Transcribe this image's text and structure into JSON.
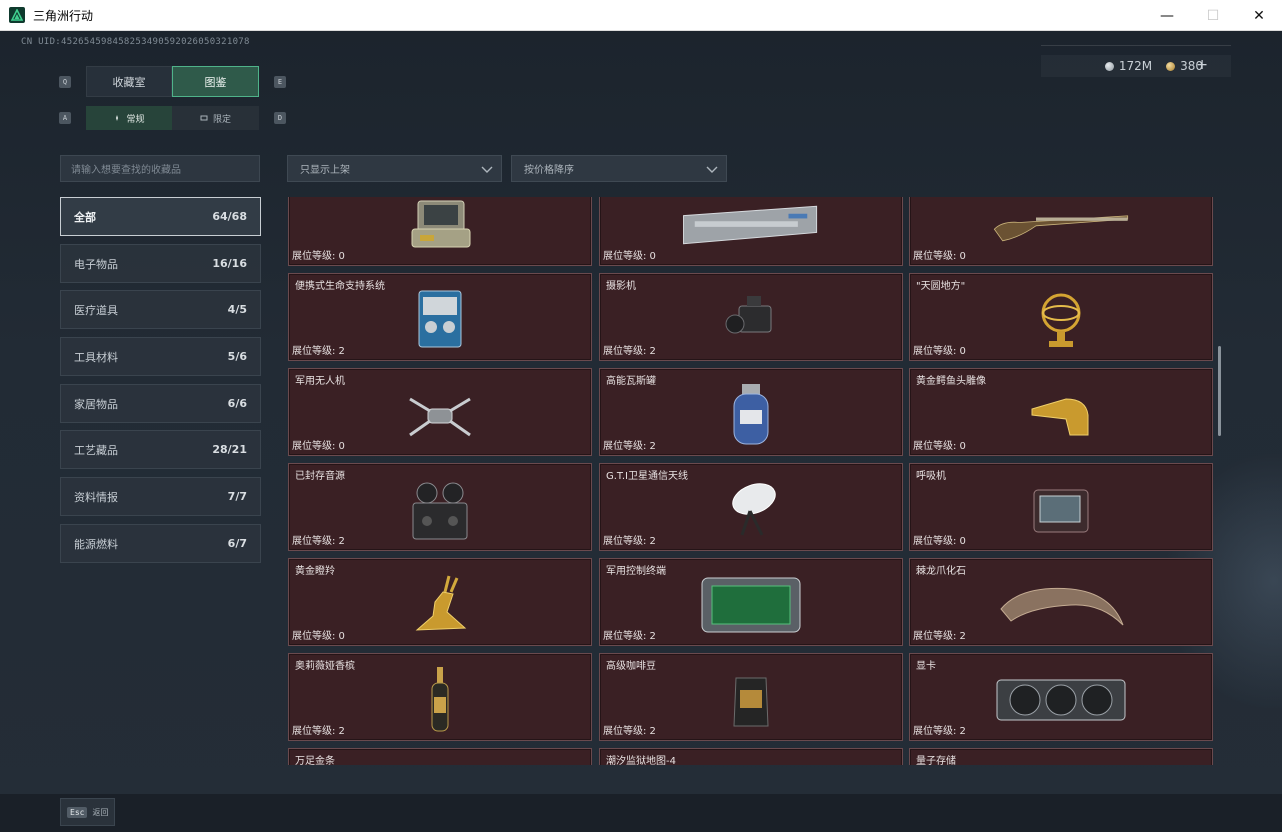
{
  "window": {
    "title": "三角洲行动",
    "minimize": "—",
    "maximize": "☐",
    "close": "✕"
  },
  "header": {
    "uid": "CN UID:452654598458253490592026050321078",
    "currency": [
      {
        "icon": "silver-coin-icon",
        "value": "172M"
      },
      {
        "icon": "gold-coin-icon",
        "value": "380"
      }
    ],
    "add": "+"
  },
  "tabs": {
    "left_key": "Q",
    "right_key": "E",
    "items": [
      "收藏室",
      "图鉴"
    ],
    "active": 1
  },
  "subtabs": {
    "left_key": "A",
    "right_key": "D",
    "items": [
      "常规",
      "限定"
    ],
    "active": 0
  },
  "search": {
    "placeholder": "请输入想要查找的收藏品"
  },
  "filters": [
    {
      "label": "只显示上架"
    },
    {
      "label": "按价格降序"
    }
  ],
  "categories": [
    {
      "label": "全部",
      "count": "64/68",
      "active": true
    },
    {
      "label": "电子物品",
      "count": "16/16"
    },
    {
      "label": "医疗道具",
      "count": "4/5"
    },
    {
      "label": "工具材料",
      "count": "5/6"
    },
    {
      "label": "家居物品",
      "count": "6/6"
    },
    {
      "label": "工艺藏品",
      "count": "28/21"
    },
    {
      "label": "资料情报",
      "count": "7/7"
    },
    {
      "label": "能源燃料",
      "count": "6/7"
    }
  ],
  "items": [
    {
      "name": "",
      "level": "展位等级: 0",
      "art": "case-icon"
    },
    {
      "name": "",
      "level": "展位等级: 0",
      "art": "server-icon"
    },
    {
      "name": "",
      "level": "展位等级: 0",
      "art": "rifle-icon"
    },
    {
      "name": "便携式生命支持系统",
      "level": "展位等级: 2",
      "art": "life-support-icon"
    },
    {
      "name": "摄影机",
      "level": "展位等级: 2",
      "art": "camera-icon"
    },
    {
      "name": "\"天圆地方\"",
      "level": "展位等级: 0",
      "art": "armillary-icon"
    },
    {
      "name": "军用无人机",
      "level": "展位等级: 0",
      "art": "drone-icon"
    },
    {
      "name": "高能瓦斯罐",
      "level": "展位等级: 2",
      "art": "gas-tank-icon"
    },
    {
      "name": "黄金鳄鱼头雕像",
      "level": "展位等级: 0",
      "art": "croc-head-icon"
    },
    {
      "name": "已封存音源",
      "level": "展位等级: 2",
      "art": "tape-recorder-icon"
    },
    {
      "name": "G.T.I卫星通信天线",
      "level": "展位等级: 2",
      "art": "satellite-dish-icon"
    },
    {
      "name": "呼吸机",
      "level": "展位等级: 0",
      "art": "ventilator-icon"
    },
    {
      "name": "黄金瞪羚",
      "level": "展位等级: 0",
      "art": "gazelle-icon"
    },
    {
      "name": "军用控制终端",
      "level": "展位等级: 2",
      "art": "terminal-icon"
    },
    {
      "name": "棘龙爪化石",
      "level": "展位等级: 2",
      "art": "claw-fossil-icon"
    },
    {
      "name": "奥莉薇娅香槟",
      "level": "展位等级: 2",
      "art": "champagne-icon"
    },
    {
      "name": "高级咖啡豆",
      "level": "展位等级: 2",
      "art": "coffee-bag-icon"
    },
    {
      "name": "显卡",
      "level": "展位等级: 2",
      "art": "gpu-icon"
    },
    {
      "name": "万足金条",
      "level": "",
      "art": "gold-bar-icon"
    },
    {
      "name": "潮汐监狱地图-4",
      "level": "",
      "art": "map-icon"
    },
    {
      "name": "量子存储",
      "level": "",
      "art": "quantum-storage-icon"
    }
  ],
  "footer": {
    "key": "Esc",
    "label": "返回"
  },
  "colors": {
    "accent": "#4fb38a",
    "card_bg": "#3a2024",
    "card_border": "#6a4a4e"
  }
}
